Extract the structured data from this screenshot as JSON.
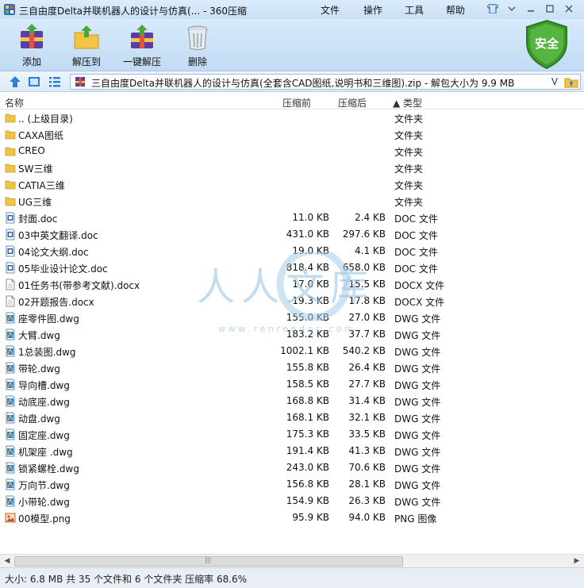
{
  "window": {
    "title": "三自由度Delta并联机器人的设计与仿真(... - 360压缩",
    "menus": [
      "文件",
      "操作",
      "工具",
      "帮助"
    ]
  },
  "toolbar": {
    "add": "添加",
    "extract_to": "解压到",
    "one_click_extract": "一键解压",
    "delete": "删除",
    "security_badge": "安全"
  },
  "address": {
    "path": "三自由度Delta并联机器人的设计与仿真(全套含CAD图纸,说明书和三维图).zip - 解包大小为 9.9 MB",
    "dropdown_glyph": "V"
  },
  "columns": {
    "name": "名称",
    "original_size": "压缩前",
    "compressed_size": "压缩后",
    "type": "▲ 类型"
  },
  "files": [
    {
      "icon": "folder-icon",
      "name": ".. (上级目录)",
      "orig": "",
      "comp": "",
      "type": "文件夹"
    },
    {
      "icon": "folder-icon",
      "name": "CAXA图纸",
      "orig": "",
      "comp": "",
      "type": "文件夹"
    },
    {
      "icon": "folder-icon",
      "name": "CREO",
      "orig": "",
      "comp": "",
      "type": "文件夹"
    },
    {
      "icon": "folder-icon",
      "name": "SW三维",
      "orig": "",
      "comp": "",
      "type": "文件夹"
    },
    {
      "icon": "folder-icon",
      "name": "CATIA三维",
      "orig": "",
      "comp": "",
      "type": "文件夹"
    },
    {
      "icon": "folder-icon",
      "name": "UG三维",
      "orig": "",
      "comp": "",
      "type": "文件夹"
    },
    {
      "icon": "doc-file-icon",
      "name": "封面.doc",
      "orig": "11.0 KB",
      "comp": "2.4 KB",
      "type": "DOC 文件"
    },
    {
      "icon": "doc-file-icon",
      "name": "03中英文翻译.doc",
      "orig": "431.0 KB",
      "comp": "297.6 KB",
      "type": "DOC 文件"
    },
    {
      "icon": "doc-file-icon",
      "name": "04论文大纲.doc",
      "orig": "19.0 KB",
      "comp": "4.1 KB",
      "type": "DOC 文件"
    },
    {
      "icon": "doc-file-icon",
      "name": "05毕业设计论文.doc",
      "orig": "818.4 KB",
      "comp": "658.0 KB",
      "type": "DOC 文件"
    },
    {
      "icon": "docx-file-icon",
      "name": "01任务书(带参考文献).docx",
      "orig": "17.0 KB",
      "comp": "15.5 KB",
      "type": "DOCX 文件"
    },
    {
      "icon": "docx-file-icon",
      "name": "02开题报告.docx",
      "orig": "19.3 KB",
      "comp": "17.8 KB",
      "type": "DOCX 文件"
    },
    {
      "icon": "dwg-file-icon",
      "name": "座零件图.dwg",
      "orig": "155.0 KB",
      "comp": "27.0 KB",
      "type": "DWG 文件"
    },
    {
      "icon": "dwg-file-icon",
      "name": "大臂.dwg",
      "orig": "183.2 KB",
      "comp": "37.7 KB",
      "type": "DWG 文件"
    },
    {
      "icon": "dwg-file-icon",
      "name": "1总装图.dwg",
      "orig": "1002.1 KB",
      "comp": "540.2 KB",
      "type": "DWG 文件"
    },
    {
      "icon": "dwg-file-icon",
      "name": "带轮.dwg",
      "orig": "155.8 KB",
      "comp": "26.4 KB",
      "type": "DWG 文件"
    },
    {
      "icon": "dwg-file-icon",
      "name": "导向槽.dwg",
      "orig": "158.5 KB",
      "comp": "27.7 KB",
      "type": "DWG 文件"
    },
    {
      "icon": "dwg-file-icon",
      "name": "动底座.dwg",
      "orig": "168.8 KB",
      "comp": "31.4 KB",
      "type": "DWG 文件"
    },
    {
      "icon": "dwg-file-icon",
      "name": "动盘.dwg",
      "orig": "168.1 KB",
      "comp": "32.1 KB",
      "type": "DWG 文件"
    },
    {
      "icon": "dwg-file-icon",
      "name": "固定座.dwg",
      "orig": "175.3 KB",
      "comp": "33.5 KB",
      "type": "DWG 文件"
    },
    {
      "icon": "dwg-file-icon",
      "name": "机架座 .dwg",
      "orig": "191.4 KB",
      "comp": "41.3 KB",
      "type": "DWG 文件"
    },
    {
      "icon": "dwg-file-icon",
      "name": "锁紧螺栓.dwg",
      "orig": "243.0 KB",
      "comp": "70.6 KB",
      "type": "DWG 文件"
    },
    {
      "icon": "dwg-file-icon",
      "name": "万向节.dwg",
      "orig": "156.8 KB",
      "comp": "28.1 KB",
      "type": "DWG 文件"
    },
    {
      "icon": "dwg-file-icon",
      "name": "小带轮.dwg",
      "orig": "154.9 KB",
      "comp": "26.3 KB",
      "type": "DWG 文件"
    },
    {
      "icon": "png-file-icon",
      "name": "00模型.png",
      "orig": "95.9 KB",
      "comp": "94.0 KB",
      "type": "PNG 图像"
    }
  ],
  "watermark": {
    "text": "人人文库",
    "url": "w w w . r e n r e n d o c . c o m"
  },
  "status": {
    "text": "大小: 6.8 MB 共 35 个文件和 6 个文件夹 压缩率 68.6%"
  },
  "colors": {
    "accent": "#2d7fd4",
    "shield_green": "#3d9a2c",
    "folder_yellow": "#f2c443"
  }
}
